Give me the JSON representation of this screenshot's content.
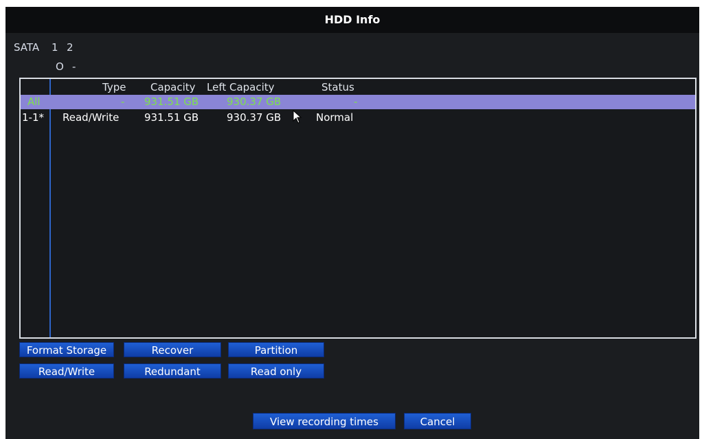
{
  "window": {
    "title": "HDD Info"
  },
  "sata": {
    "label": "SATA",
    "ports": [
      "1",
      "2"
    ],
    "port_status": [
      "O",
      "-"
    ]
  },
  "table": {
    "headers": [
      "Type",
      "Capacity",
      "Left Capacity",
      "Status"
    ],
    "rows": [
      {
        "name": "All",
        "type": "-",
        "capacity": "931.51 GB",
        "left": "930.37 GB",
        "status": "-",
        "selected": true
      },
      {
        "name": "1-1*",
        "type": "Read/Write",
        "capacity": "931.51 GB",
        "left": "930.37 GB",
        "status": "Normal",
        "selected": false
      }
    ]
  },
  "buttons": {
    "format_storage": "Format Storage",
    "recover": "Recover",
    "partition": "Partition",
    "read_write": "Read/Write",
    "redundant": "Redundant",
    "read_only": "Read only",
    "view_recording_times": "View recording times",
    "cancel": "Cancel"
  },
  "colors": {
    "button": "#1a52c8",
    "selected_row": "#8a85d6",
    "selected_text": "#7fe04d",
    "divider": "#2e64c8"
  }
}
